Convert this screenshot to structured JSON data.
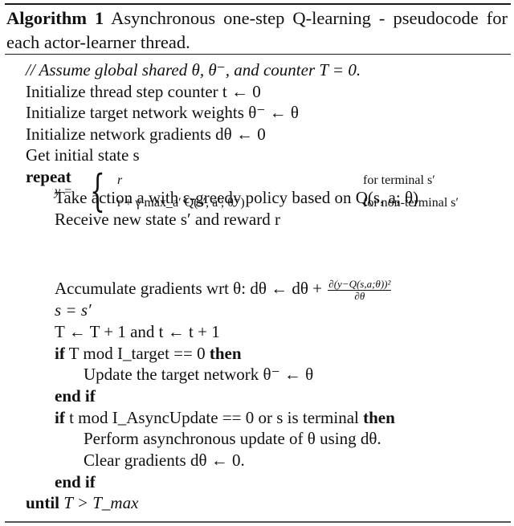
{
  "caption": {
    "label": "Algorithm 1",
    "text": "Asynchronous one-step Q-learning - pseudocode for each actor-learner thread."
  },
  "lines": {
    "comment": "// Assume global shared θ, θ⁻, and counter T = 0.",
    "init_t": "Initialize thread step counter t ← 0",
    "init_target": "Initialize target network weights θ⁻ ← θ",
    "init_grad": "Initialize network gradients dθ ← 0",
    "get_state": "Get initial state s",
    "repeat": "repeat",
    "take_action": "Take action a with ε-greedy policy based on Q(s, a; θ)",
    "receive": "Receive new state s′ and reward r",
    "y_lhs": "y =",
    "y_case1": "r",
    "y_case1_cond": "for terminal s′",
    "y_case2": "r + γ max_a′ Q(s′, a′; θ⁻)",
    "y_case2_cond": "for non-terminal s′",
    "accumulate": "Accumulate gradients wrt θ: dθ ← dθ +",
    "accumulate_frac_num": "∂(y−Q(s,a;θ))²",
    "accumulate_frac_den": "∂θ",
    "assign_s": "s = s′",
    "increment": "T ← T + 1 and t ← t + 1",
    "if_target_kw": "if",
    "if_target_cond": "T  mod I_target == 0",
    "then1": "then",
    "update_target": "Update the target network θ⁻ ← θ",
    "end_if1": "end if",
    "if_async_kw": "if",
    "if_async_cond": "t  mod I_AsyncUpdate == 0 or s is terminal",
    "then2": "then",
    "perform_update": "Perform asynchronous update of θ using dθ.",
    "clear_grad": "Clear gradients dθ ← 0.",
    "end_if2": "end if",
    "until_kw": "until",
    "until_cond": "T > T_max"
  }
}
